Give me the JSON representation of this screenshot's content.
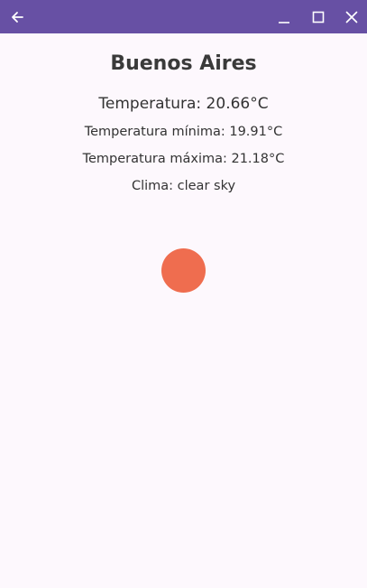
{
  "titlebar": {
    "background": "#6750a4",
    "icons": [
      "arrow-left-icon",
      "minimize-icon",
      "maximize-icon",
      "close-icon"
    ]
  },
  "weather": {
    "city": "Buenos Aires",
    "temperature": "Temperatura: 20.66°C",
    "temp_min": "Temperatura mínima: 19.91°C",
    "temp_max": "Temperatura máxima: 21.18°C",
    "condition": "Clima: clear sky",
    "icon": "sun-icon",
    "icon_color": "#ef6d4f"
  }
}
